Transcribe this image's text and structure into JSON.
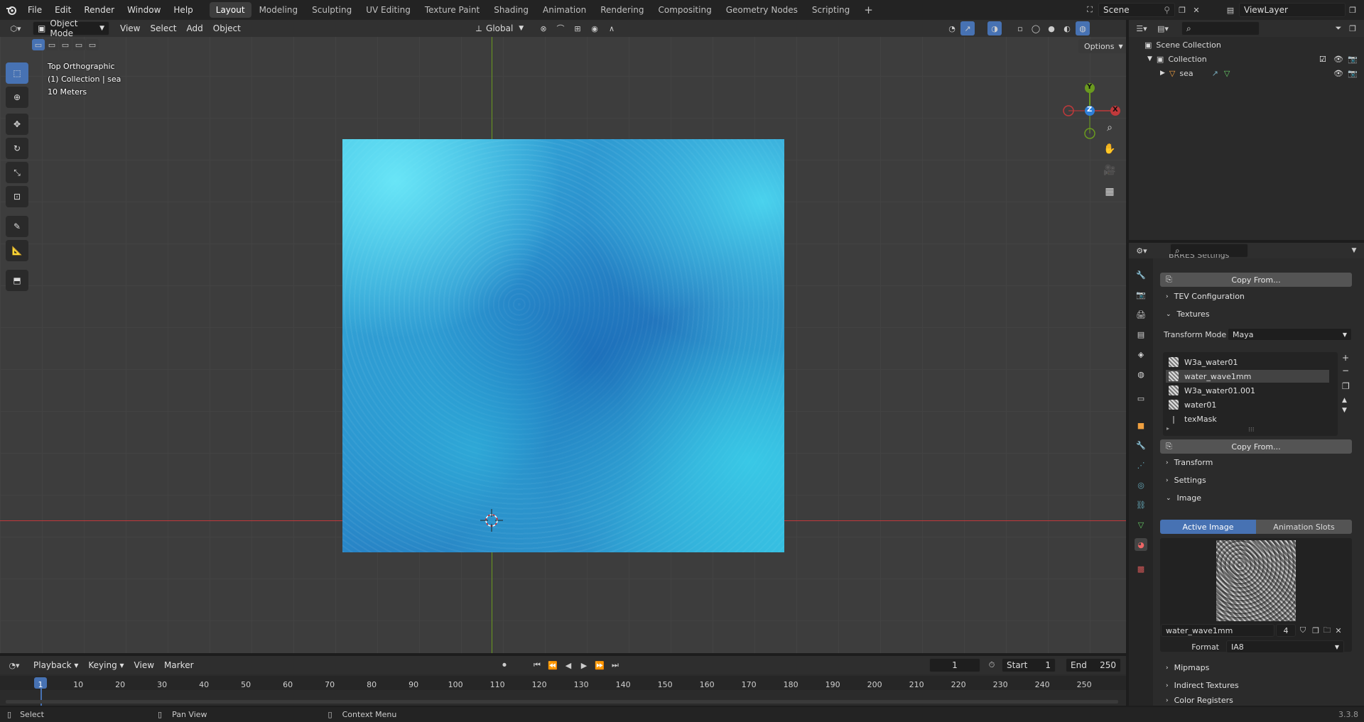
{
  "topbar": {
    "menus": [
      "File",
      "Edit",
      "Render",
      "Window",
      "Help"
    ],
    "workspaces": [
      "Layout",
      "Modeling",
      "Sculpting",
      "UV Editing",
      "Texture Paint",
      "Shading",
      "Animation",
      "Rendering",
      "Compositing",
      "Geometry Nodes",
      "Scripting"
    ],
    "active_workspace": "Layout",
    "add_tab": "+",
    "scene": "Scene",
    "view_layer": "ViewLayer"
  },
  "viewport": {
    "mode": "Object Mode",
    "menus": [
      "View",
      "Select",
      "Add",
      "Object"
    ],
    "orientation": "Global",
    "options": "Options",
    "overlay_lines": [
      "Top Orthographic",
      "(1) Collection | sea",
      "10 Meters"
    ],
    "gizmo": {
      "x": "X",
      "y": "Y",
      "z": "Z"
    }
  },
  "outliner": {
    "title": "Scene Collection",
    "items": [
      {
        "label": "Collection"
      },
      {
        "label": "sea"
      }
    ]
  },
  "properties": {
    "partial_header": "BRRES Settings",
    "copy_from": "Copy From...",
    "tev_configuration": "TEV Configuration",
    "textures": "Textures",
    "transform_mode_label": "Transform Mode",
    "transform_mode_value": "Maya",
    "texture_list": [
      "W3a_water01",
      "water_wave1mm",
      "W3a_water01.001",
      "water01",
      "texMask"
    ],
    "selected_texture": "water_wave1mm",
    "copy_from_2": "Copy From...",
    "transform": "Transform",
    "settings": "Settings",
    "image": "Image",
    "active_image": "Active Image",
    "animation_slots": "Animation Slots",
    "image_name": "water_wave1mm",
    "image_users": "4",
    "format_label": "Format",
    "format_value": "IA8",
    "mipmaps": "Mipmaps",
    "indirect_textures": "Indirect Textures",
    "color_registers": "Color Registers"
  },
  "timeline": {
    "menus": [
      "Playback",
      "Keying",
      "View",
      "Marker"
    ],
    "current_frame": "1",
    "start_label": "Start",
    "start": "1",
    "end_label": "End",
    "end": "250",
    "ticks": [
      "1",
      "10",
      "20",
      "30",
      "40",
      "50",
      "60",
      "70",
      "80",
      "90",
      "100",
      "110",
      "120",
      "130",
      "140",
      "150",
      "160",
      "170",
      "180",
      "190",
      "200",
      "210",
      "220",
      "230",
      "240",
      "250"
    ]
  },
  "statusbar": {
    "select": "Select",
    "pan_view": "Pan View",
    "context_menu": "Context Menu",
    "version": "3.3.8"
  },
  "colors": {
    "accent": "#4772b3",
    "x_axis": "#c0393b",
    "y_axis": "#6a9a1f",
    "z_axis": "#2f7fd8"
  }
}
